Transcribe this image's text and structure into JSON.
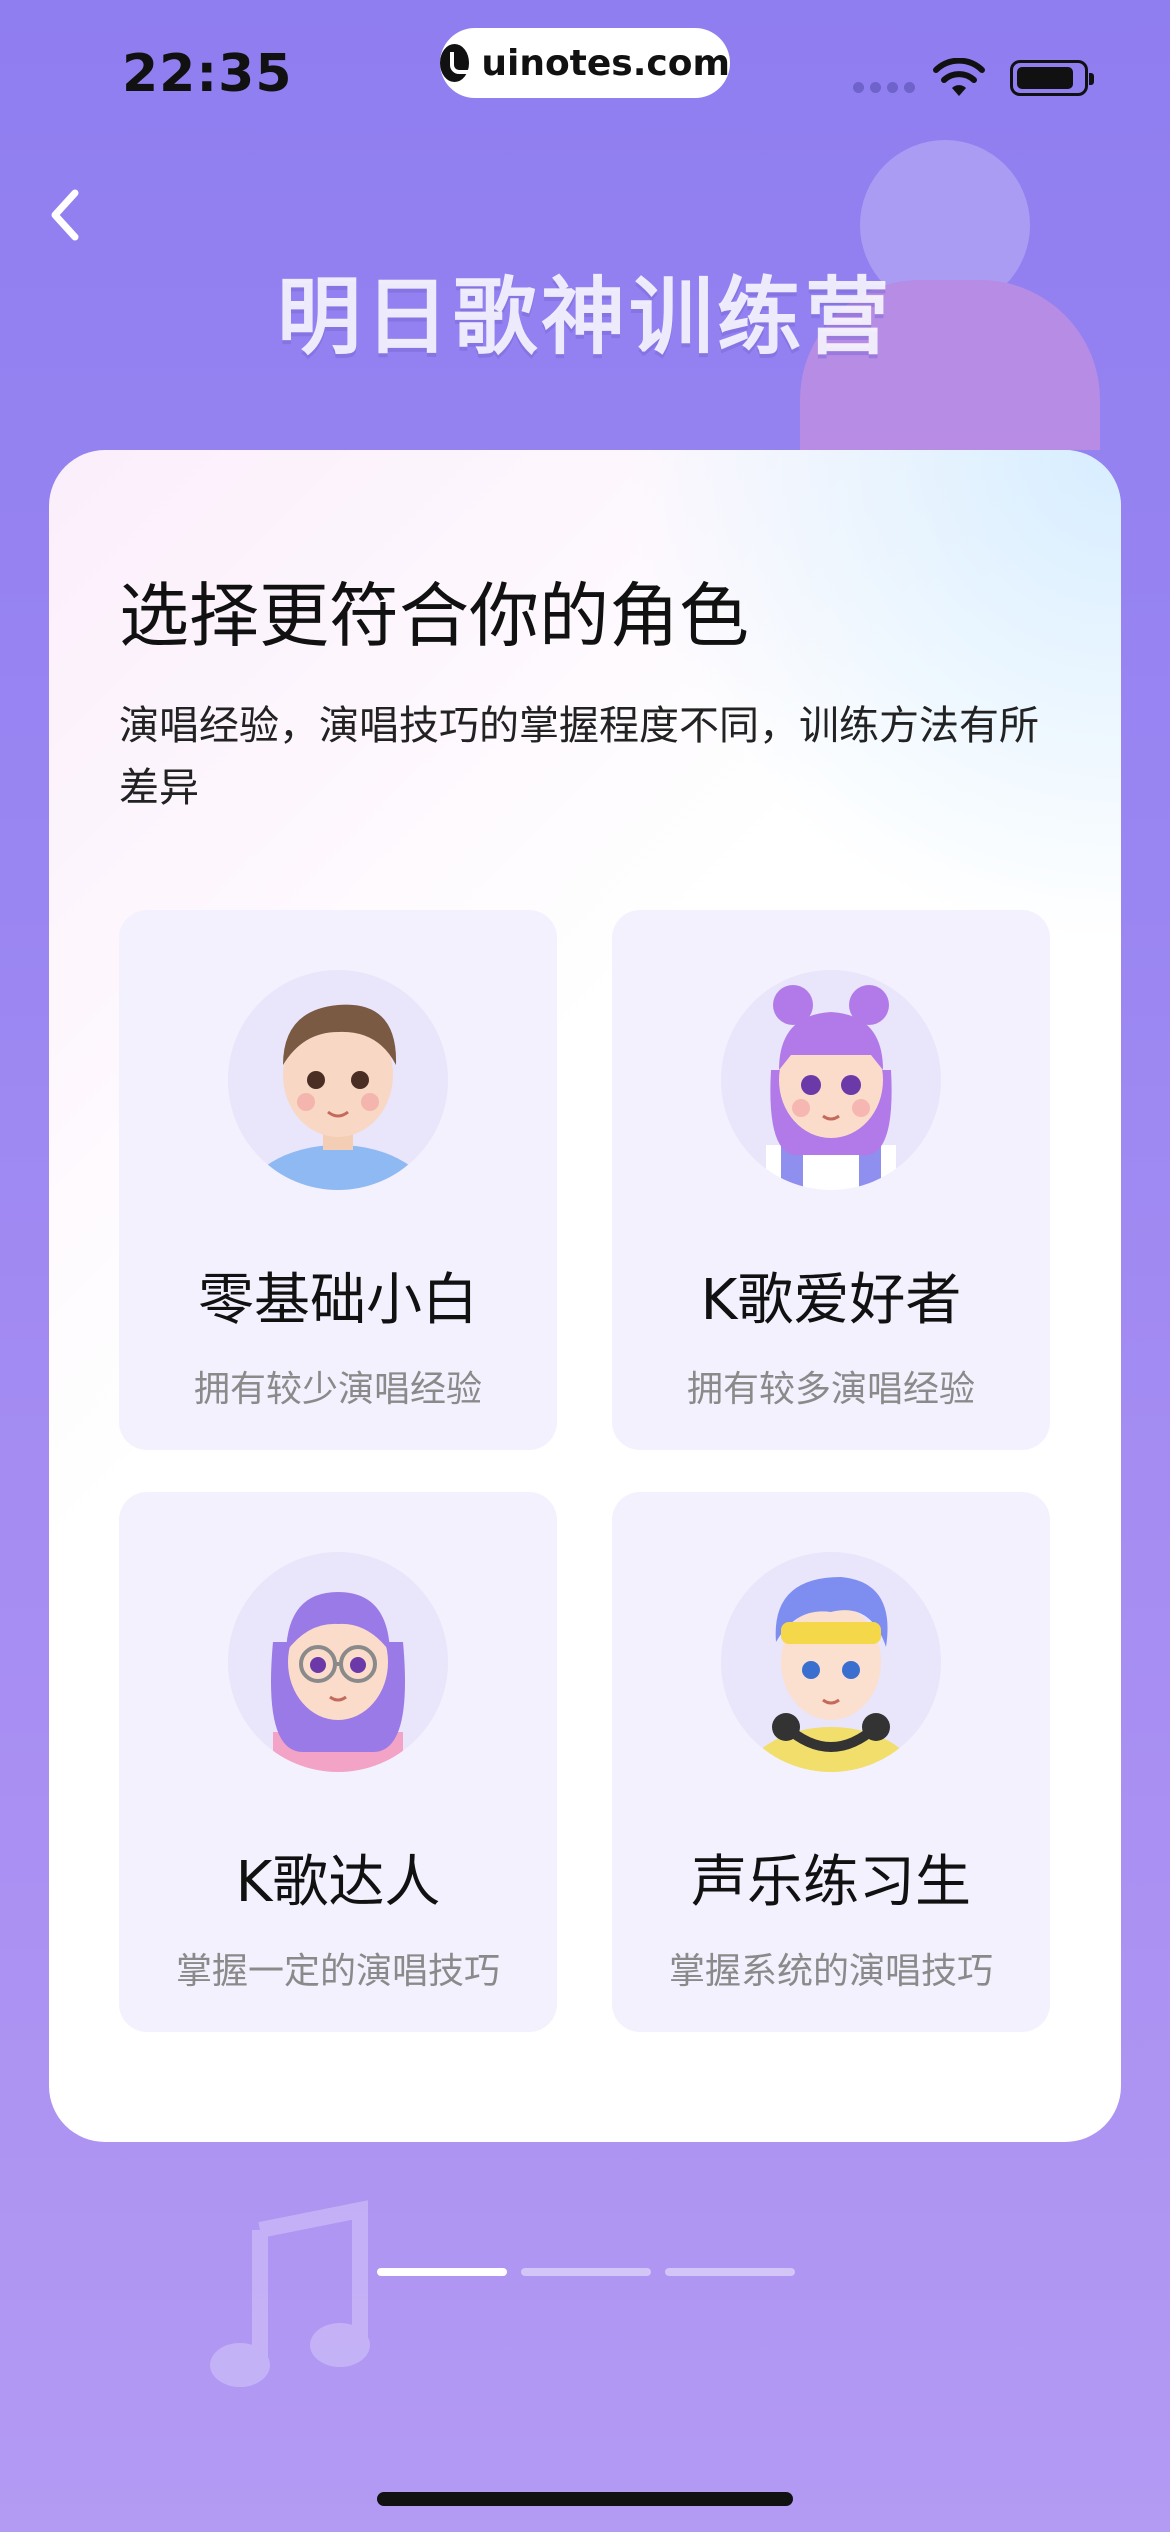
{
  "status_bar": {
    "time": "22:35",
    "url": "uinotes.com",
    "icons": [
      "signal-icon",
      "wifi-icon",
      "battery-icon"
    ]
  },
  "header": {
    "back_icon": "chevron-left-icon",
    "title": "明日歌神训练营"
  },
  "card": {
    "title": "选择更符合你的角色",
    "description": "演唱经验，演唱技巧的掌握程度不同，训练方法有所差异"
  },
  "options": [
    {
      "title": "零基础小白",
      "subtitle": "拥有较少演唱经验",
      "avatar": "boy-avatar"
    },
    {
      "title": "K歌爱好者",
      "subtitle": "拥有较多演唱经验",
      "avatar": "girl-purple-bun-avatar"
    },
    {
      "title": "K歌达人",
      "subtitle": "掌握一定的演唱技巧",
      "avatar": "girl-glasses-avatar"
    },
    {
      "title": "声乐练习生",
      "subtitle": "掌握系统的演唱技巧",
      "avatar": "boy-headphones-avatar"
    }
  ],
  "pagination": {
    "total": 3,
    "current": 1
  },
  "colors": {
    "background_top": "#8f7ef0",
    "background_bottom": "#b39af3",
    "card_bg": "#ffffff",
    "option_bg": "#f3f1fd",
    "subtitle_gray": "#8a8a8a"
  }
}
